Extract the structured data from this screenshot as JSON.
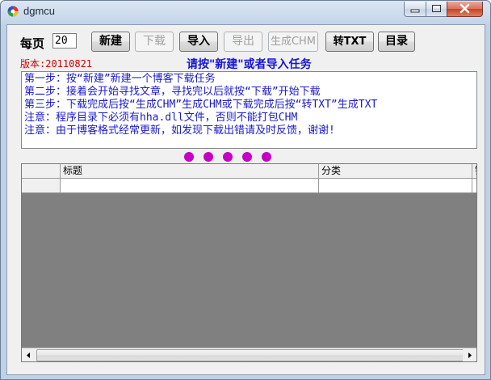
{
  "window": {
    "title": "dgmcu"
  },
  "toolbar": {
    "perpage_label": "每页",
    "perpage_value": "20",
    "buttons": {
      "new": "新建",
      "download": "下载",
      "import": "导入",
      "export": "导出",
      "make_chm": "生成CHM",
      "to_txt": "转TXT",
      "catalog": "目录"
    }
  },
  "version_label": "版本:20110821",
  "prompt": "请按\"新建\"或者导入任务",
  "instructions": [
    "第一步：按“新建”新建一个博客下载任务",
    "第二步：接着会开始寻找文章，寻找完以后就按“下载”开始下载",
    "第三步：下载完成后按“生成CHM”生成CHM或下载完成后按“转TXT”生成TXT",
    "注意：程序目录下必须有hha.dll文件，否则不能打包CHM",
    "注意：由于博客格式经常更新，如发现下载出错请及时反馈，谢谢!"
  ],
  "grid": {
    "columns": [
      "",
      "标题",
      "分类",
      "链"
    ],
    "rows": [
      [
        "",
        "",
        "",
        ""
      ]
    ]
  },
  "colors": {
    "prompt": "#1515d6",
    "version": "#cc0000",
    "instructions": "#1a1acd",
    "dots": "#c400c4",
    "grid_empty": "#808080"
  },
  "icons": {
    "app": "dgmcu-app-icon",
    "minimize": "minimize-icon",
    "maximize": "maximize-icon",
    "close": "close-icon"
  }
}
